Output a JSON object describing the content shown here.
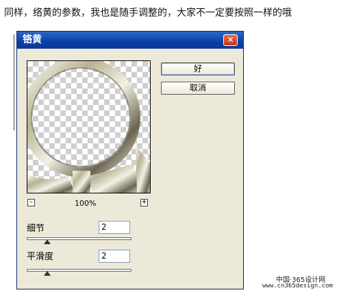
{
  "caption": "同样，络黄的参数，我也是随手调整的，大家不一定要按照一样的哦",
  "dialog": {
    "title": "铬黄",
    "close_icon": "close-icon",
    "ok_label": "好",
    "cancel_label": "取消",
    "zoom": {
      "minus": "–",
      "plus": "+",
      "level": "100%"
    },
    "detail": {
      "label": "细节",
      "value": "2"
    },
    "smoothness": {
      "label": "平滑度",
      "value": "2"
    }
  },
  "watermark": {
    "line1": "中国·365设计网",
    "line2": "www.cn365design.com"
  },
  "colors": {
    "title_bar": "#0a3fa8",
    "dialog_bg": "#ece9d8",
    "close_button": "#c13619"
  }
}
